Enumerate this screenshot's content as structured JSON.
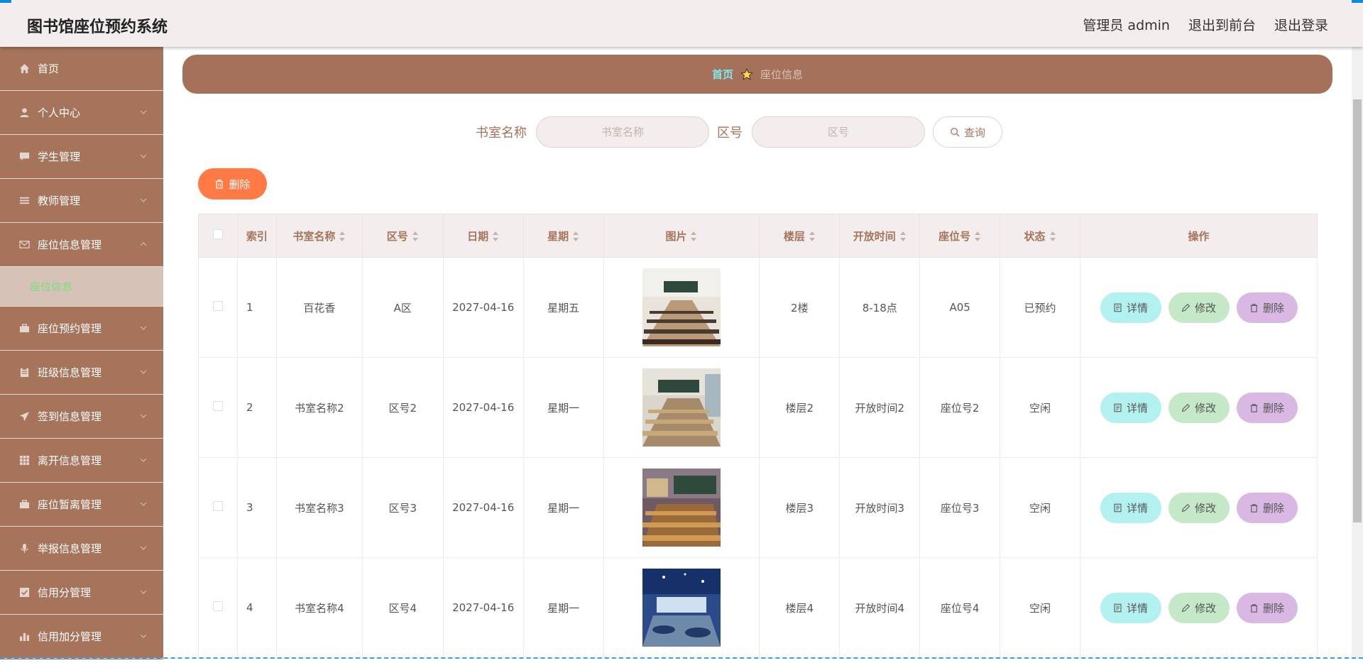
{
  "header": {
    "title": "图书馆座位预约系统",
    "admin_label": "管理员 admin",
    "to_front_label": "退出到前台",
    "logout_label": "退出登录"
  },
  "sidebar": {
    "items": [
      {
        "label": "首页",
        "icon": "home-icon"
      },
      {
        "label": "个人中心",
        "icon": "user-icon"
      },
      {
        "label": "学生管理",
        "icon": "chat-icon"
      },
      {
        "label": "教师管理",
        "icon": "list-icon"
      },
      {
        "label": "座位信息管理",
        "icon": "mail-icon"
      },
      {
        "label": "座位预约管理",
        "icon": "suitcase-icon"
      },
      {
        "label": "班级信息管理",
        "icon": "clipboard-icon"
      },
      {
        "label": "签到信息管理",
        "icon": "send-icon"
      },
      {
        "label": "离开信息管理",
        "icon": "grid-icon"
      },
      {
        "label": "座位暂离管理",
        "icon": "briefcase-icon"
      },
      {
        "label": "举报信息管理",
        "icon": "mic-icon"
      },
      {
        "label": "信用分管理",
        "icon": "check-icon"
      },
      {
        "label": "信用加分管理",
        "icon": "bar-chart-icon"
      }
    ],
    "submenu": {
      "label": "座位信息"
    }
  },
  "breadcrumb": {
    "home": "首页",
    "current": "座位信息"
  },
  "search": {
    "room_label": "书室名称",
    "room_placeholder": "书室名称",
    "area_label": "区号",
    "area_placeholder": "区号",
    "query_label": "查询"
  },
  "toolbar": {
    "delete_label": "删除"
  },
  "table": {
    "headers": [
      "索引",
      "书室名称",
      "区号",
      "日期",
      "星期",
      "图片",
      "楼层",
      "开放时间",
      "座位号",
      "状态",
      "操作"
    ],
    "rows": [
      {
        "idx": "1",
        "room": "百花香",
        "area": "A区",
        "date": "2027-04-16",
        "weekday": "星期五",
        "floor": "2楼",
        "open": "8-18点",
        "seat": "A05",
        "status": "已预约"
      },
      {
        "idx": "2",
        "room": "书室名称2",
        "area": "区号2",
        "date": "2027-04-16",
        "weekday": "星期一",
        "floor": "楼层2",
        "open": "开放时间2",
        "seat": "座位号2",
        "status": "空闲"
      },
      {
        "idx": "3",
        "room": "书室名称3",
        "area": "区号3",
        "date": "2027-04-16",
        "weekday": "星期一",
        "floor": "楼层3",
        "open": "开放时间3",
        "seat": "座位号3",
        "status": "空闲"
      },
      {
        "idx": "4",
        "room": "书室名称4",
        "area": "区号4",
        "date": "2027-04-16",
        "weekday": "星期一",
        "floor": "楼层4",
        "open": "开放时间4",
        "seat": "座位号4",
        "status": "空闲"
      }
    ],
    "actions": {
      "detail": "详情",
      "edit": "修改",
      "delete": "删除"
    }
  },
  "colors": {
    "sidebar_bg": "#a5745a",
    "accent": "#a5745a",
    "breadcrumb_home": "#7ee8ec",
    "submenu_active_text": "#7be07b",
    "delete_button": "#ff7a45",
    "detail_button": "#b3f0f0",
    "edit_button": "#c5e8c8",
    "remove_button": "#d9b8e4"
  }
}
